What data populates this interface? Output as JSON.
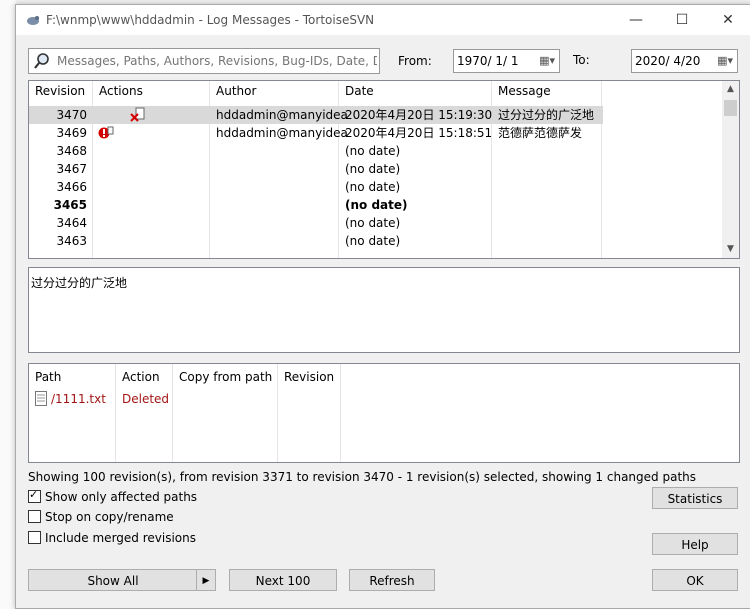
{
  "window": {
    "title": "F:\\wnmp\\www\\hddadmin - Log Messages - TortoiseSVN",
    "minimize": "—",
    "maximize": "☐",
    "close": "✕"
  },
  "filter": {
    "placeholder": "Messages, Paths, Authors, Revisions, Bug-IDs, Date, D",
    "from_label": "From:",
    "from_value": "1970/  1/  1",
    "to_label": "To:",
    "to_value": "2020/  4/20"
  },
  "log": {
    "columns": [
      "Revision",
      "Actions",
      "Author",
      "Date",
      "Message"
    ],
    "rows": [
      {
        "revision": "3470",
        "author": "hddadmin@manyidea",
        "date": "2020年4月20日 15:19:30",
        "message": "过分过分的广泛地",
        "selected": true,
        "action_icon": "delete-icon"
      },
      {
        "revision": "3469",
        "author": "hddadmin@manyidea",
        "date": "2020年4月20日 15:18:51",
        "message": "范德萨范德萨发",
        "action_icon": "error-icon"
      },
      {
        "revision": "3468",
        "author": "",
        "date": "(no date)",
        "message": ""
      },
      {
        "revision": "3467",
        "author": "",
        "date": "(no date)",
        "message": ""
      },
      {
        "revision": "3466",
        "author": "",
        "date": "(no date)",
        "message": ""
      },
      {
        "revision": "3465",
        "author": "",
        "date": "(no date)",
        "message": "",
        "bold": true
      },
      {
        "revision": "3464",
        "author": "",
        "date": "(no date)",
        "message": ""
      },
      {
        "revision": "3463",
        "author": "",
        "date": "(no date)",
        "message": ""
      }
    ]
  },
  "message_text": "过分过分的广泛地",
  "paths": {
    "columns": [
      "Path",
      "Action",
      "Copy from path",
      "Revision"
    ],
    "rows": [
      {
        "path": "/1111.txt",
        "action": "Deleted",
        "copy_from": "",
        "revision": ""
      }
    ]
  },
  "status_text": "Showing 100 revision(s), from revision 3371 to revision 3470 - 1 revision(s) selected, showing 1 changed paths",
  "options": {
    "affected": "Show only affected paths",
    "stop_copy": "Stop on copy/rename",
    "merged": "Include merged revisions"
  },
  "buttons": {
    "statistics": "Statistics",
    "help": "Help",
    "show_all": "Show All",
    "next100": "Next 100",
    "refresh": "Refresh",
    "ok": "OK"
  },
  "colors": {
    "deleted_text": "#a31515",
    "selected_row": "#d9d9d9",
    "error_red": "#d40000"
  }
}
